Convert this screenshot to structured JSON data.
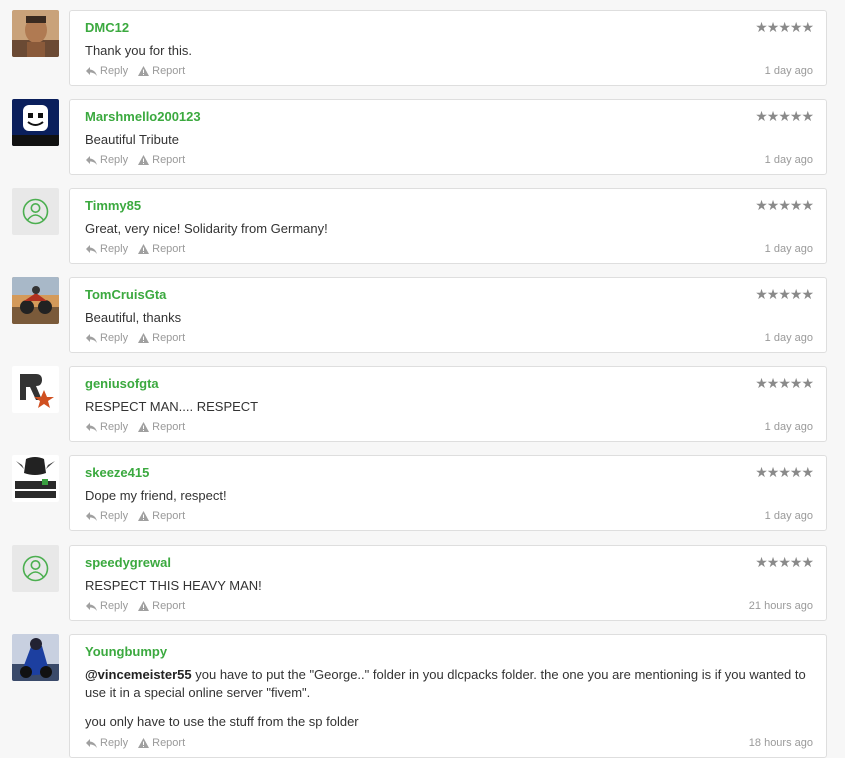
{
  "comments": [
    {
      "username": "DMC12",
      "text": [
        "Thank you for this."
      ],
      "time": "1 day ago",
      "avatar": "portrait-avatar"
    },
    {
      "username": "Marshmello200123",
      "text": [
        "Beautiful Tribute"
      ],
      "time": "1 day ago",
      "avatar": "marshmello-avatar"
    },
    {
      "username": "Timmy85",
      "text": [
        "Great, very nice! Solidarity from Germany!"
      ],
      "time": "1 day ago",
      "avatar": "default-user-icon"
    },
    {
      "username": "TomCruisGta",
      "text": [
        "Beautiful, thanks"
      ],
      "time": "1 day ago",
      "avatar": "motorbike-avatar"
    },
    {
      "username": "geniusofgta",
      "text": [
        "RESPECT MAN.... RESPECT"
      ],
      "time": "1 day ago",
      "avatar": "rockstar-logo-avatar"
    },
    {
      "username": "skeeze415",
      "text": [
        "Dope my friend, respect!"
      ],
      "time": "1 day ago",
      "avatar": "games-graphics-avatar"
    },
    {
      "username": "speedygrewal",
      "text": [
        "RESPECT THIS HEAVY MAN!"
      ],
      "time": "21 hours ago",
      "avatar": "default-user-icon"
    },
    {
      "username": "Youngbumpy",
      "mention": "@vincemeister55",
      "mention_rest": " you have to put the \"George..\" folder in you dlcpacks folder. the one you are mentioning is if you wanted to use it in a special online server \"fivem\".",
      "text": [
        "you only have to use the stuff from the sp folder"
      ],
      "time": "18 hours ago",
      "avatar": "blue-biker-avatar"
    }
  ],
  "labels": {
    "reply": "Reply",
    "report": "Report",
    "stars": "★★★★★"
  },
  "colors": {
    "username": "#3ba93f",
    "icon_green": "#4caf50",
    "meta": "#9a9a9a",
    "stars": "#8a8a8a"
  }
}
